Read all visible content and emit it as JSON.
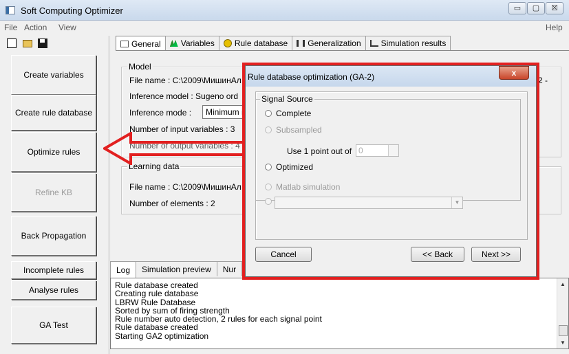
{
  "window": {
    "title": "Soft Computing Optimizer",
    "min": "▭",
    "max": "▢",
    "close": "☒"
  },
  "menu": {
    "file": "File",
    "action": "Action",
    "view": "View",
    "help": "Help"
  },
  "left_buttons": {
    "create_variables": "Create variables",
    "create_rule_database": "Create rule database",
    "optimize_rules": "Optimize rules",
    "refine_kb": "Refine KB",
    "back_propagation": "Back Propagation",
    "incomplete_rules": "Incomplete rules",
    "analyse_rules": "Analyse rules",
    "ga_test": "GA Test"
  },
  "tabs": {
    "general": "General",
    "variables": "Variables",
    "rule_database": "Rule database",
    "generalization": "Generalization",
    "simulation_results": "Simulation results"
  },
  "general": {
    "model_legend": "Model",
    "file_name": "File name :  C:\\2009\\МишинАл",
    "inference_model": "Inference model :   Sugeno ord",
    "inference_mode_label": "Inference mode :",
    "inference_mode_value": "Minimum i",
    "num_input": "Number of input variables :  3",
    "num_output": "Number of output variables :  4",
    "right_clip": "2 -",
    "learning_legend": "Learning data",
    "learn_file": "File name :  C:\\2009\\МишинАл",
    "num_elements": "Number of elements :  2"
  },
  "bottom_tabs": {
    "log": "Log",
    "simulation_preview": "Simulation preview",
    "num": "Nur"
  },
  "log_lines": [
    "Rule database created",
    "Creating rule database",
    "LBRW Rule Database",
    "Sorted by sum of firing strength",
    "Rule number auto detection, 2 rules for each signal point",
    "Rule database created",
    "Starting GA2 optimization"
  ],
  "dialog": {
    "title": "Rule database optimization (GA-2)",
    "close": "x",
    "group": "Signal Source",
    "complete": "Complete",
    "subsampled": "Subsampled",
    "use_label": "Use 1 point out of",
    "use_value": "0",
    "optimized": "Optimized",
    "matlab": "Matlab simulation",
    "cancel": "Cancel",
    "back": "<< Back",
    "next": "Next >>"
  },
  "colors": {
    "highlight": "#e22020",
    "titlebar": "#c9d9ec"
  }
}
